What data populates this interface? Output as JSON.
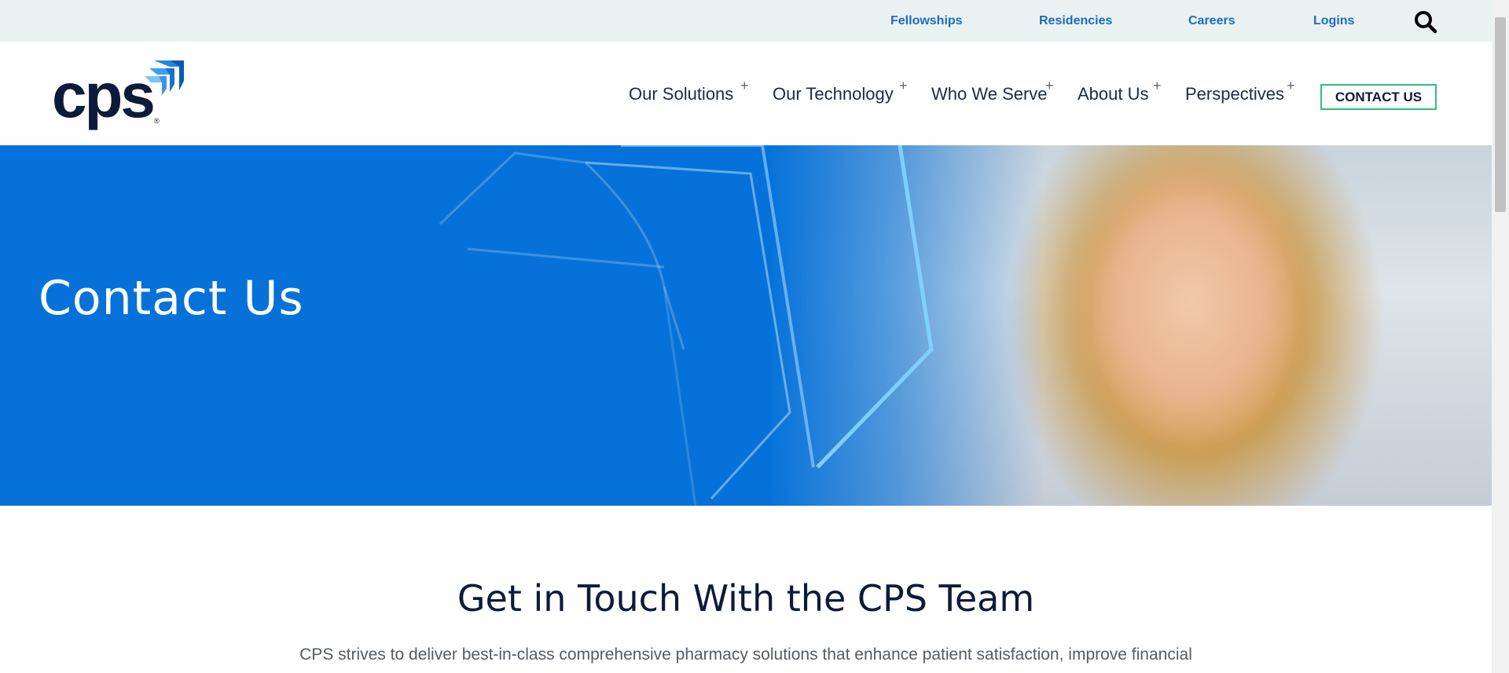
{
  "utility_nav": {
    "links": [
      "Fellowships",
      "Residencies",
      "Careers",
      "Logins"
    ],
    "search_icon": "search-icon"
  },
  "logo": {
    "text": "cps",
    "mark": "registered"
  },
  "main_nav": {
    "items": [
      "Our Solutions",
      "Our Technology",
      "Who We Serve",
      "About Us",
      "Perspectives"
    ],
    "expand_symbol": "+",
    "cta": "CONTACT US",
    "cta_border_color": "#2ec07a"
  },
  "hero": {
    "title": "Contact Us",
    "background_color": "#0672d9"
  },
  "section": {
    "title": "Get in Touch With the CPS Team",
    "body": "CPS strives to deliver best-in-class comprehensive pharmacy solutions that enhance patient satisfaction, improve financial"
  },
  "colors": {
    "link_blue": "#1a6cc4",
    "navy": "#0d1b3a",
    "utility_bg": "#eaf2f1"
  }
}
